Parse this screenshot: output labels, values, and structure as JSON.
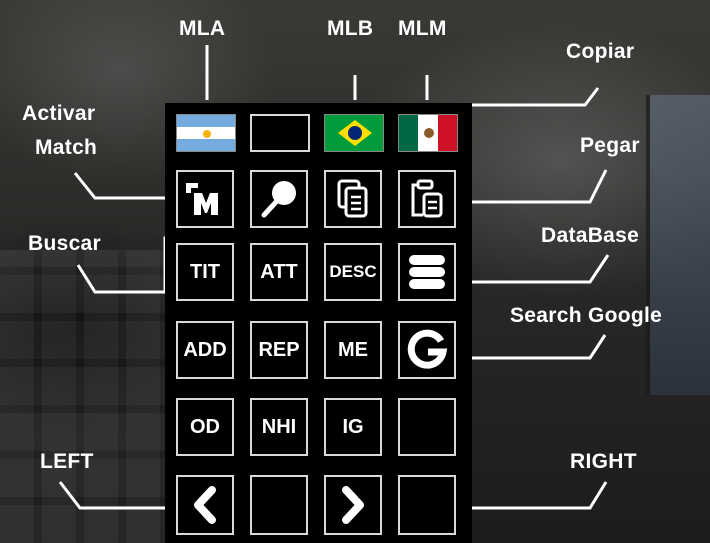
{
  "labels": {
    "mla": "MLA",
    "mlb": "MLB",
    "mlm": "MLM",
    "copiar": "Copiar",
    "activar": "Activar",
    "match": "Match",
    "pegar": "Pegar",
    "buscar": "Buscar",
    "database": "DataBase",
    "search_google": "Search Google",
    "left": "LEFT",
    "right": "RIGHT"
  },
  "flags": [
    "argentina-flag",
    "empty",
    "brazil-flag",
    "mexico-flag"
  ],
  "buttons": {
    "row2": [
      "match-logo-icon",
      "search-pin-icon",
      "copy-icon",
      "paste-icon"
    ],
    "row3": [
      "TIT",
      "ATT",
      "DESC",
      "database-icon"
    ],
    "row4": [
      "ADD",
      "REP",
      "ME",
      "google-g-icon"
    ],
    "row5": [
      "OD",
      "NHI",
      "IG",
      ""
    ],
    "row6": [
      "chevron-left-icon",
      "",
      "chevron-right-icon",
      ""
    ]
  },
  "text": {
    "tit": "TIT",
    "att": "ATT",
    "desc": "DESC",
    "add": "ADD",
    "rep": "REP",
    "me": "ME",
    "od": "OD",
    "nhi": "NHI",
    "ig": "IG"
  },
  "colors": {
    "panel": "#000000",
    "border": "#d9d9d9",
    "text": "#ffffff",
    "argentina_blue": "#74acdf",
    "brazil_green": "#009c3b",
    "mexico_green": "#006847",
    "mexico_red": "#ce1126"
  }
}
